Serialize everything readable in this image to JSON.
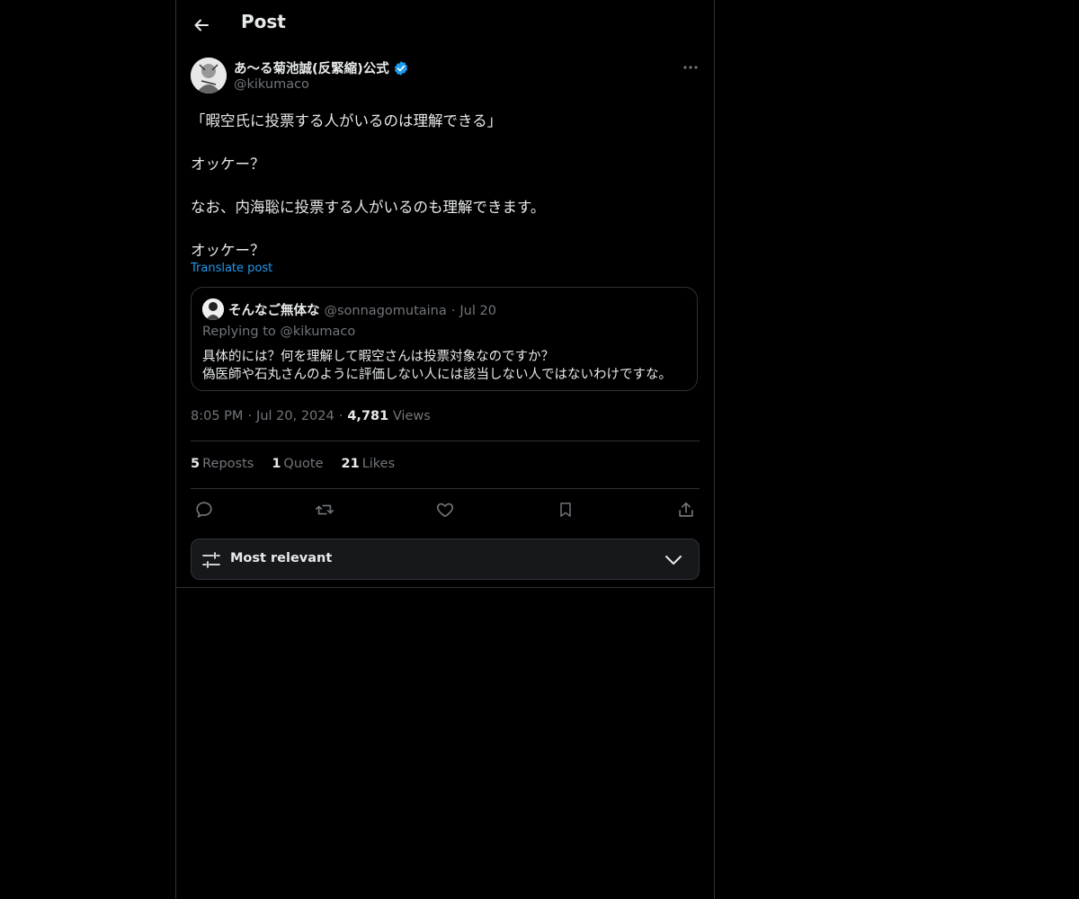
{
  "header": {
    "title": "Post"
  },
  "post": {
    "author_name": "あ〜る菊池誠(反緊縮)公式",
    "author_handle": "@kikumaco",
    "lines": [
      "「暇空氏に投票する人がいるのは理解できる」",
      "オッケー？",
      "なお、内海聡に投票する人がいるのも理解できます。",
      "オッケー？"
    ],
    "translate_label": "Translate post",
    "time": "8:05 PM",
    "date": "Jul 20, 2024",
    "views_count": "4,781",
    "views_label": "Views"
  },
  "quote": {
    "name": "そんなご無体な",
    "handle": "@sonnagomutaina",
    "date": "Jul 20",
    "replying": "Replying to @kikumaco",
    "lines": [
      "具体的には？何を理解して暇空さんは投票対象なのですか？",
      "偽医師や石丸さんのように評価しない人には該当しない人ではないわけですな。"
    ]
  },
  "stats": {
    "reposts_count": "5",
    "reposts_label": "Reposts",
    "quotes_count": "1",
    "quotes_label": "Quote",
    "likes_count": "21",
    "likes_label": "Likes"
  },
  "sort": {
    "label": "Most relevant"
  },
  "colors": {
    "background": "#000000",
    "accent": "#1d9bf0",
    "border": "#2f3336",
    "muted": "#71767b"
  }
}
